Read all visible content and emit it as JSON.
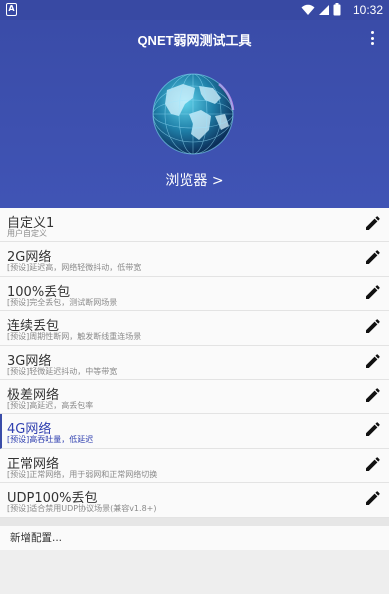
{
  "statusbar": {
    "app_icon_letter": "A",
    "time": "10:32"
  },
  "header": {
    "title": "QNET弱网测试工具",
    "browser_label": "浏览器 >"
  },
  "profiles": [
    {
      "name": "自定义1",
      "desc": "用户自定义"
    },
    {
      "name": "2G网络",
      "desc": "[预设]延迟高，网络轻微抖动，低带宽"
    },
    {
      "name": "100%丢包",
      "desc": "[预设]完全丢包，测试断网场景"
    },
    {
      "name": "连续丢包",
      "desc": "[预设]周期性断网，触发断线重连场景"
    },
    {
      "name": "3G网络",
      "desc": "[预设]轻微延迟抖动，中等带宽"
    },
    {
      "name": "极差网络",
      "desc": "[预设]高延迟，高丢包率"
    },
    {
      "name": "4G网络",
      "desc": "[预设]高吞吐量，低延迟",
      "active": true
    },
    {
      "name": "正常网络",
      "desc": "[预设]正常网络，用于弱网和正常网络切换"
    },
    {
      "name": "UDP100%丢包",
      "desc": "[预设]适合禁用UDP协议场景(兼容v1.8+)"
    }
  ],
  "add_config_label": "新增配置...",
  "colors": {
    "primary": "#3f51b5",
    "active_text": "#3040b0"
  }
}
